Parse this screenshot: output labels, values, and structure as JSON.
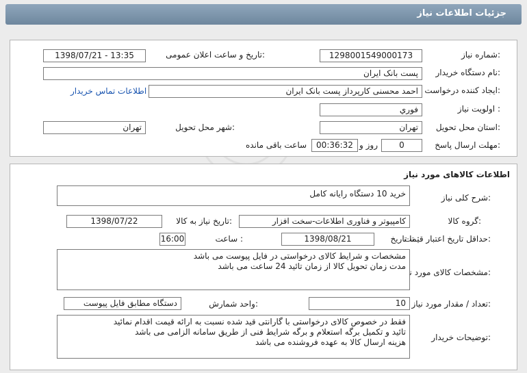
{
  "header": {
    "title": "جزئیات اطلاعات نیاز"
  },
  "info": {
    "need_number_label": "شماره نیاز:",
    "need_number": "1298001549000173",
    "announce_label": "تاریخ و ساعت اعلان عمومی:",
    "announce_value": "1398/07/21 - 13:35",
    "buyer_label": "نام دستگاه خریدار:",
    "buyer_value": "پست بانک ایران",
    "creator_label": "ایجاد کننده درخواست:",
    "creator_value": "احمد  محسنی کارپرداز پست بانک ایران",
    "contact_link": "اطلاعات تماس خریدار",
    "priority_label": "اولویت نیاز :",
    "priority_value": "فوري",
    "province_label": "استان محل تحویل:",
    "province_value": "تهران",
    "city_label": "شهر محل تحویل:",
    "city_value": "تهران",
    "deadline_label": "مهلت ارسال پاسخ:",
    "days_value": "0",
    "days_suffix": "روز و",
    "time_value": "00:36:32",
    "time_suffix": "ساعت باقی مانده"
  },
  "goods": {
    "section_title": "اطلاعات کالاهای مورد نیاز",
    "summary_label": "شرح کلی نیاز:",
    "summary_value": "خرید 10 دستگاه رایانه کامل",
    "group_label": "گروه کالا:",
    "group_value": "کامپیوتر و فناوری اطلاعات-سخت افزار",
    "need_date_label": "تاریخ نیاز به کالا:",
    "need_date_value": "1398/07/22",
    "validity_label": "حداقل تاریخ اعتبار قیمت:",
    "until_date_label": "تا تاریخ :",
    "until_date_value": "1398/08/21",
    "hour_label": "ساعت :",
    "hour_value": "16:00",
    "specs_label": "مشخصات کالای مورد نیاز:",
    "specs_lines": [
      "مشخصات و شرایط کالای درخواستی در فایل پیوست می باشد",
      "مدت زمان تحویل کالا از زمان تائید 24 ساعت می باشد"
    ],
    "qty_label": "تعداد / مقدار مورد نیاز:",
    "qty_value": "10",
    "unit_label": "واحد شمارش:",
    "unit_value": "دستگاه مطابق فایل پیوست",
    "notes_label": "توضیحات خریدار:",
    "notes_lines": [
      "فقط در خصوص کالای درخواستی با گارانتی قید شده نسبت به ارائه قیمت اقدام نمائید",
      "تائید و تکمیل برگه استعلام و برگه شرایط فنی از طریق سامانه الزامی می باشد",
      "هزینه ارسال کالا به عهده فروشنده می باشد"
    ]
  },
  "colors": {
    "header": "#7f97ad",
    "link": "#1a55b0",
    "border": "#7a7a7a"
  }
}
